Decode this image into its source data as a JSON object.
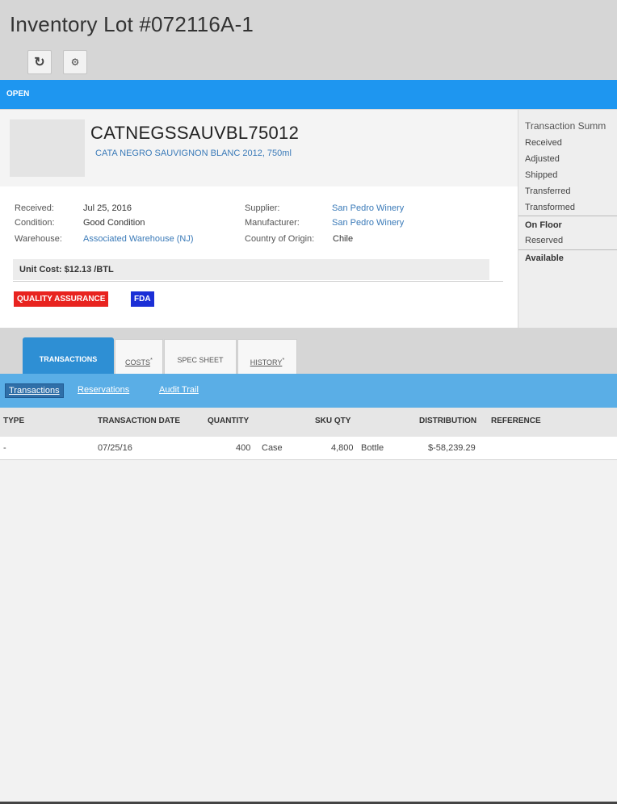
{
  "page": {
    "title": "Inventory Lot #072116A-1"
  },
  "toolbar": {
    "refresh_icon": "↻",
    "settings_icon": "⚙"
  },
  "status": {
    "label": "OPEN",
    "color": "#1e96f0"
  },
  "product": {
    "sku": "CATNEGSSAUVBL75012",
    "description": "CATA NEGRO SAUVIGNON BLANC 2012, 750ml"
  },
  "details": {
    "received_label": "Received:",
    "received_value": "Jul 25, 2016",
    "condition_label": "Condition:",
    "condition_value": "Good Condition",
    "warehouse_label": "Warehouse:",
    "warehouse_value": "Associated Warehouse (NJ)",
    "supplier_label": "Supplier:",
    "supplier_value": "San Pedro Winery",
    "manufacturer_label": "Manufacturer:",
    "manufacturer_value": "San Pedro Winery",
    "origin_label": "Country of Origin:",
    "origin_value": "Chile"
  },
  "unit_cost": "Unit Cost: $12.13 /BTL",
  "tags": [
    {
      "label": "QUALITY ASSURANCE",
      "color": "#e8231f"
    },
    {
      "label": "FDA",
      "color": "#1b2fd6"
    }
  ],
  "summary": {
    "title": "Transaction Summ",
    "items": [
      "Received",
      "Adjusted",
      "Shipped",
      "Transferred",
      "Transformed"
    ],
    "on_floor": "On Floor",
    "reserved": "Reserved",
    "available": "Available"
  },
  "tabs": [
    {
      "label": "TRANSACTIONS"
    },
    {
      "label": "COSTS",
      "mark": "*"
    },
    {
      "label": "SPEC SHEET"
    },
    {
      "label": "HISTORY",
      "mark": "*"
    }
  ],
  "subnav": [
    "Transactions",
    "Reservations",
    "Audit Trail"
  ],
  "grid": {
    "columns": [
      "TYPE",
      "TRANSACTION DATE",
      "QUANTITY",
      "SKU QTY",
      "DISTRIBUTION",
      "REFERENCE"
    ],
    "rows": [
      {
        "type": "-",
        "date": "07/25/16",
        "quantity": "400",
        "quantity_unit": "Case",
        "sku_qty": "4,800",
        "sku_unit": "Bottle",
        "distribution": "$-58,239.29",
        "reference": ""
      }
    ]
  }
}
